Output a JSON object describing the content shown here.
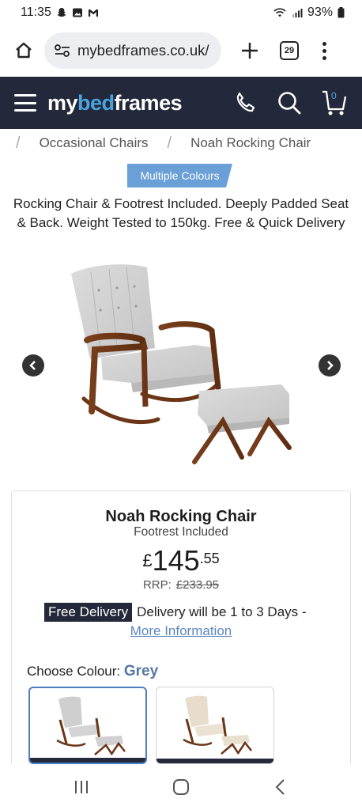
{
  "status_bar": {
    "time": "11:35",
    "battery": "93%"
  },
  "browser": {
    "url": "mybedframes.co.uk/",
    "tab_count": "29"
  },
  "site": {
    "logo_my": "my",
    "logo_bed": "bed",
    "logo_frames": "frames",
    "cart_count": "0"
  },
  "breadcrumb": {
    "items": [
      "Occasional Chairs",
      "Noah Rocking Chair"
    ]
  },
  "badge": "Multiple Colours",
  "subtitle": "Rocking Chair & Footrest Included. Deeply Padded Seat & Back. Weight Tested to 150kg. Free & Quick Delivery",
  "product": {
    "name": "Noah Rocking Chair",
    "sub": "Footrest Included",
    "currency": "£",
    "price_main": "145",
    "price_dec": ".55",
    "rrp_label": "RRP:",
    "rrp_value": "£233.95",
    "free_delivery": "Free Delivery",
    "delivery_text": "Delivery will be 1 to 3 Days -",
    "more_info": "More Information",
    "choose_label": "Choose Colour:",
    "selected_colour": "Grey"
  },
  "colors": {
    "header_bg": "#23293a",
    "accent": "#4aa3df",
    "badge": "#6a9fd8",
    "link": "#5e86c2",
    "selected_border": "#4c7fc4"
  },
  "icons": [
    "home-icon",
    "site-settings-icon",
    "plus-icon",
    "tabs-icon",
    "more-vert-icon",
    "hamburger-icon",
    "phone-icon",
    "search-icon",
    "cart-icon",
    "chevron-left-icon",
    "chevron-right-icon",
    "recent-apps-icon",
    "home-nav-icon",
    "back-icon"
  ]
}
